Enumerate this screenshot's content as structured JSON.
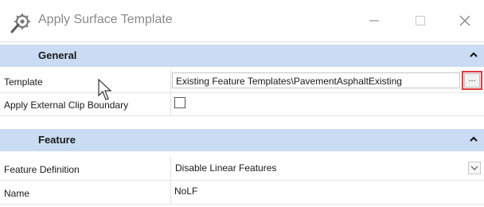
{
  "window": {
    "title": "Apply Surface Template",
    "minimize_icon": "minimize-icon",
    "maximize_icon": "maximize-icon",
    "close_icon": "close-icon"
  },
  "sections": {
    "general": {
      "label": "General"
    },
    "feature": {
      "label": "Feature"
    }
  },
  "general": {
    "template_label": "Template",
    "template_value": "Existing Feature Templates\\PavementAsphaltExisting",
    "browse_label": "...",
    "apply_clip_label": "Apply External Clip Boundary",
    "apply_clip_checked": false
  },
  "feature": {
    "definition_label": "Feature Definition",
    "definition_value": "Disable Linear Features",
    "name_label": "Name",
    "name_value": "NoLF"
  },
  "colors": {
    "section_bg": "#c9dcf3",
    "highlight": "#e0393b"
  }
}
